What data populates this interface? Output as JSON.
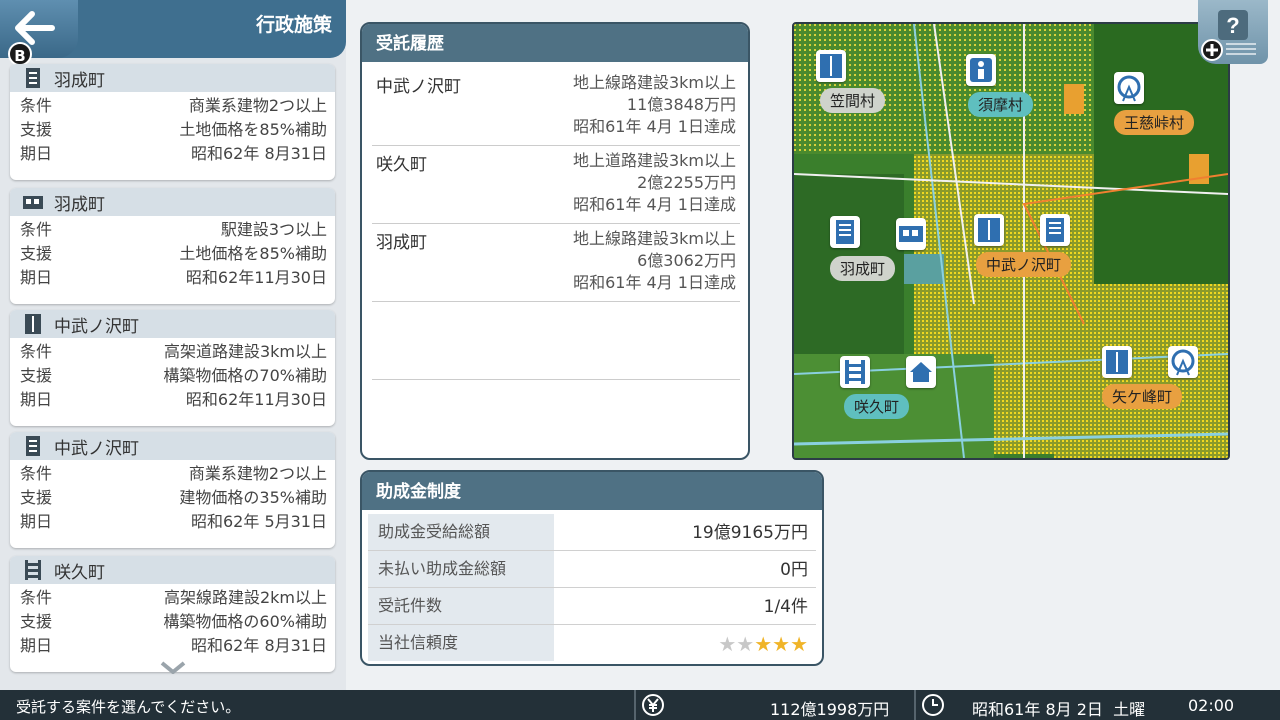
{
  "left_panel": {
    "title": "行政施策",
    "back_key": "B",
    "cards": [
      {
        "icon": "building-icon",
        "town": "羽成町",
        "rows": [
          {
            "label": "条件",
            "value": "商業系建物2つ以上"
          },
          {
            "label": "支援",
            "value": "土地価格を85%補助"
          },
          {
            "label": "期日",
            "value": "昭和62年 8月31日"
          }
        ]
      },
      {
        "icon": "station-icon",
        "town": "羽成町",
        "rows": [
          {
            "label": "条件",
            "value": "駅建設3つ以上"
          },
          {
            "label": "支援",
            "value": "土地価格を85%補助"
          },
          {
            "label": "期日",
            "value": "昭和62年11月30日"
          }
        ]
      },
      {
        "icon": "road-icon",
        "town": "中武ノ沢町",
        "rows": [
          {
            "label": "条件",
            "value": "高架道路建設3km以上"
          },
          {
            "label": "支援",
            "value": "構築物価格の70%補助"
          },
          {
            "label": "期日",
            "value": "昭和62年11月30日"
          }
        ]
      },
      {
        "icon": "building-icon",
        "town": "中武ノ沢町",
        "rows": [
          {
            "label": "条件",
            "value": "商業系建物2つ以上"
          },
          {
            "label": "支援",
            "value": "建物価格の35%補助"
          },
          {
            "label": "期日",
            "value": "昭和62年 5月31日"
          }
        ]
      },
      {
        "icon": "rail-icon",
        "town": "咲久町",
        "rows": [
          {
            "label": "条件",
            "value": "高架線路建設2km以上"
          },
          {
            "label": "支援",
            "value": "構築物価格の60%補助"
          },
          {
            "label": "期日",
            "value": "昭和62年 8月31日"
          }
        ]
      }
    ]
  },
  "history": {
    "title": "受託履歴",
    "items": [
      {
        "town": "中武ノ沢町",
        "line1": "地上線路建設3km以上",
        "line2": "11億3848万円",
        "line3": "昭和61年 4月 1日達成"
      },
      {
        "town": "咲久町",
        "line1": "地上道路建設3km以上",
        "line2": "2億2255万円",
        "line3": "昭和61年 4月 1日達成"
      },
      {
        "town": "羽成町",
        "line1": "地上線路建設3km以上",
        "line2": "6億3062万円",
        "line3": "昭和61年 4月 1日達成"
      }
    ]
  },
  "subsidy": {
    "title": "助成金制度",
    "rows": [
      {
        "label": "助成金受給総額",
        "value": "19億9165万円"
      },
      {
        "label": "未払い助成金総額",
        "value": "0円"
      },
      {
        "label": "受託件数",
        "value": "1/4件"
      },
      {
        "label": "当社信頼度",
        "value": ""
      }
    ],
    "reliability_stars": 3,
    "reliability_max": 5,
    "star_on_color": "#f0b428",
    "star_off_color": "#c8c8c8"
  },
  "map": {
    "labels": [
      {
        "text": "笠間村",
        "style": "gray"
      },
      {
        "text": "須摩村",
        "style": "teal"
      },
      {
        "text": "王慈峠村",
        "style": "orange"
      },
      {
        "text": "羽成町",
        "style": "gray"
      },
      {
        "text": "中武ノ沢町",
        "style": "orange"
      },
      {
        "text": "咲久町",
        "style": "teal"
      },
      {
        "text": "矢ケ峰町",
        "style": "orange"
      }
    ]
  },
  "status_bar": {
    "message": "受託する案件を選んでください。",
    "money": "112億1998万円",
    "date": "昭和61年 8月 2日",
    "weekday": "土曜",
    "time": "02:00"
  },
  "colors": {
    "header": "#3f6f8f",
    "panel_head": "#4f7184",
    "accent_blue": "#2f6fb0"
  }
}
